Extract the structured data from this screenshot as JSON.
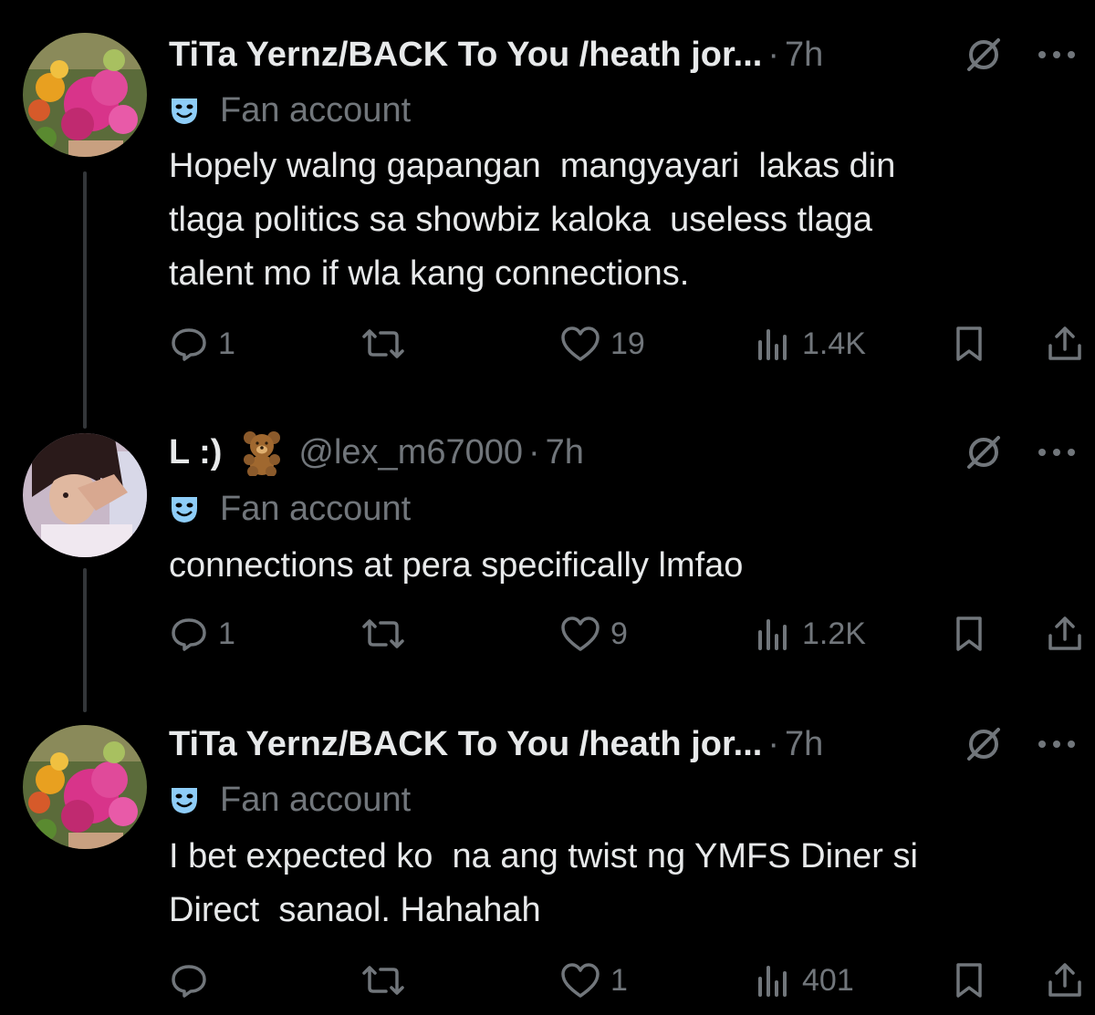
{
  "tweets": [
    {
      "display_name": "TiTa Yernz/BACK To You /heath jor...",
      "handle": "",
      "separator": "·",
      "time": "7h",
      "badge_label": "Fan account",
      "text": "Hopely walng gapangan  mangyayari  lakas din\ntlaga politics sa showbiz kaloka  useless tlaga\ntalent mo if wla kang connections.",
      "replies": "1",
      "reposts": "",
      "likes": "19",
      "views": "1.4K",
      "avatar": "flower-garden"
    },
    {
      "display_name": "L :)",
      "handle": "@lex_m67000",
      "separator": "·",
      "time": "7h",
      "badge_label": "Fan account",
      "text": "connections at pera specifically lmfao",
      "replies": "1",
      "reposts": "",
      "likes": "9",
      "views": "1.2K",
      "avatar": "girl-photo"
    },
    {
      "display_name": "TiTa Yernz/BACK To You /heath jor...",
      "handle": "",
      "separator": "·",
      "time": "7h",
      "badge_label": "Fan account",
      "text": "I bet expected ko  na ang twist ng YMFS Diner si\nDirect  sanaol. Hahahah",
      "replies": "",
      "reposts": "",
      "likes": "1",
      "views": "401",
      "avatar": "flower-garden"
    }
  ],
  "icons": {
    "header": [
      "no-entry-icon",
      "more-icon"
    ],
    "badge": "theater-mask-icon",
    "name_emoji": "teddy-bear-icon",
    "actions": [
      "reply-icon",
      "repost-icon",
      "like-icon",
      "views-icon",
      "bookmark-icon",
      "share-icon"
    ]
  },
  "colors": {
    "background": "#000000",
    "text_primary": "#e7e9ea",
    "text_secondary": "#71767b",
    "thread_line": "#333639",
    "badge": "#8ecdf8"
  }
}
